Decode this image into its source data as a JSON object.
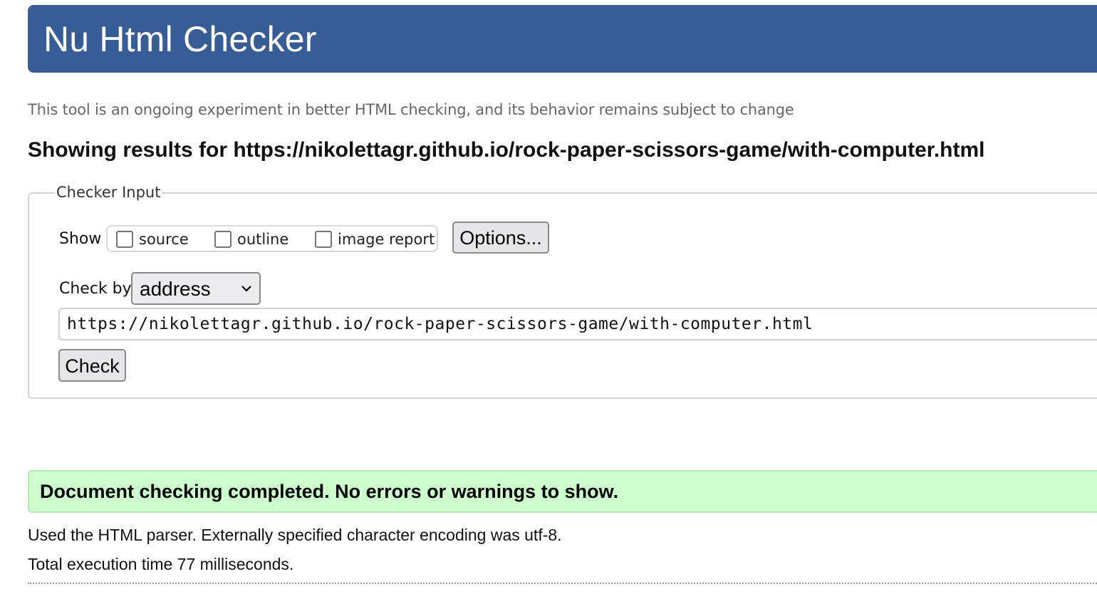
{
  "header": {
    "title": "Nu Html Checker"
  },
  "tagline": "This tool is an ongoing experiment in better HTML checking, and its behavior remains subject to change",
  "results_title": "Showing results for https://nikolettagr.github.io/rock-paper-scissors-game/with-computer.html",
  "checker_input": {
    "legend": "Checker Input",
    "show_label": "Show",
    "checkboxes": [
      {
        "label": "source",
        "checked": false
      },
      {
        "label": "outline",
        "checked": false
      },
      {
        "label": "image report",
        "checked": false
      }
    ],
    "options_label": "Options...",
    "check_by_label": "Check by",
    "check_by_value": "address",
    "url_value": "https://nikolettagr.github.io/rock-paper-scissors-game/with-computer.html",
    "check_label": "Check"
  },
  "status": {
    "message": "Document checking completed. No errors or warnings to show.",
    "color": "#ccffcc"
  },
  "info": {
    "parser": "Used the HTML parser. Externally specified character encoding was utf-8.",
    "execution": "Total execution time 77 milliseconds."
  },
  "colors": {
    "header_bg": "#365d95"
  }
}
